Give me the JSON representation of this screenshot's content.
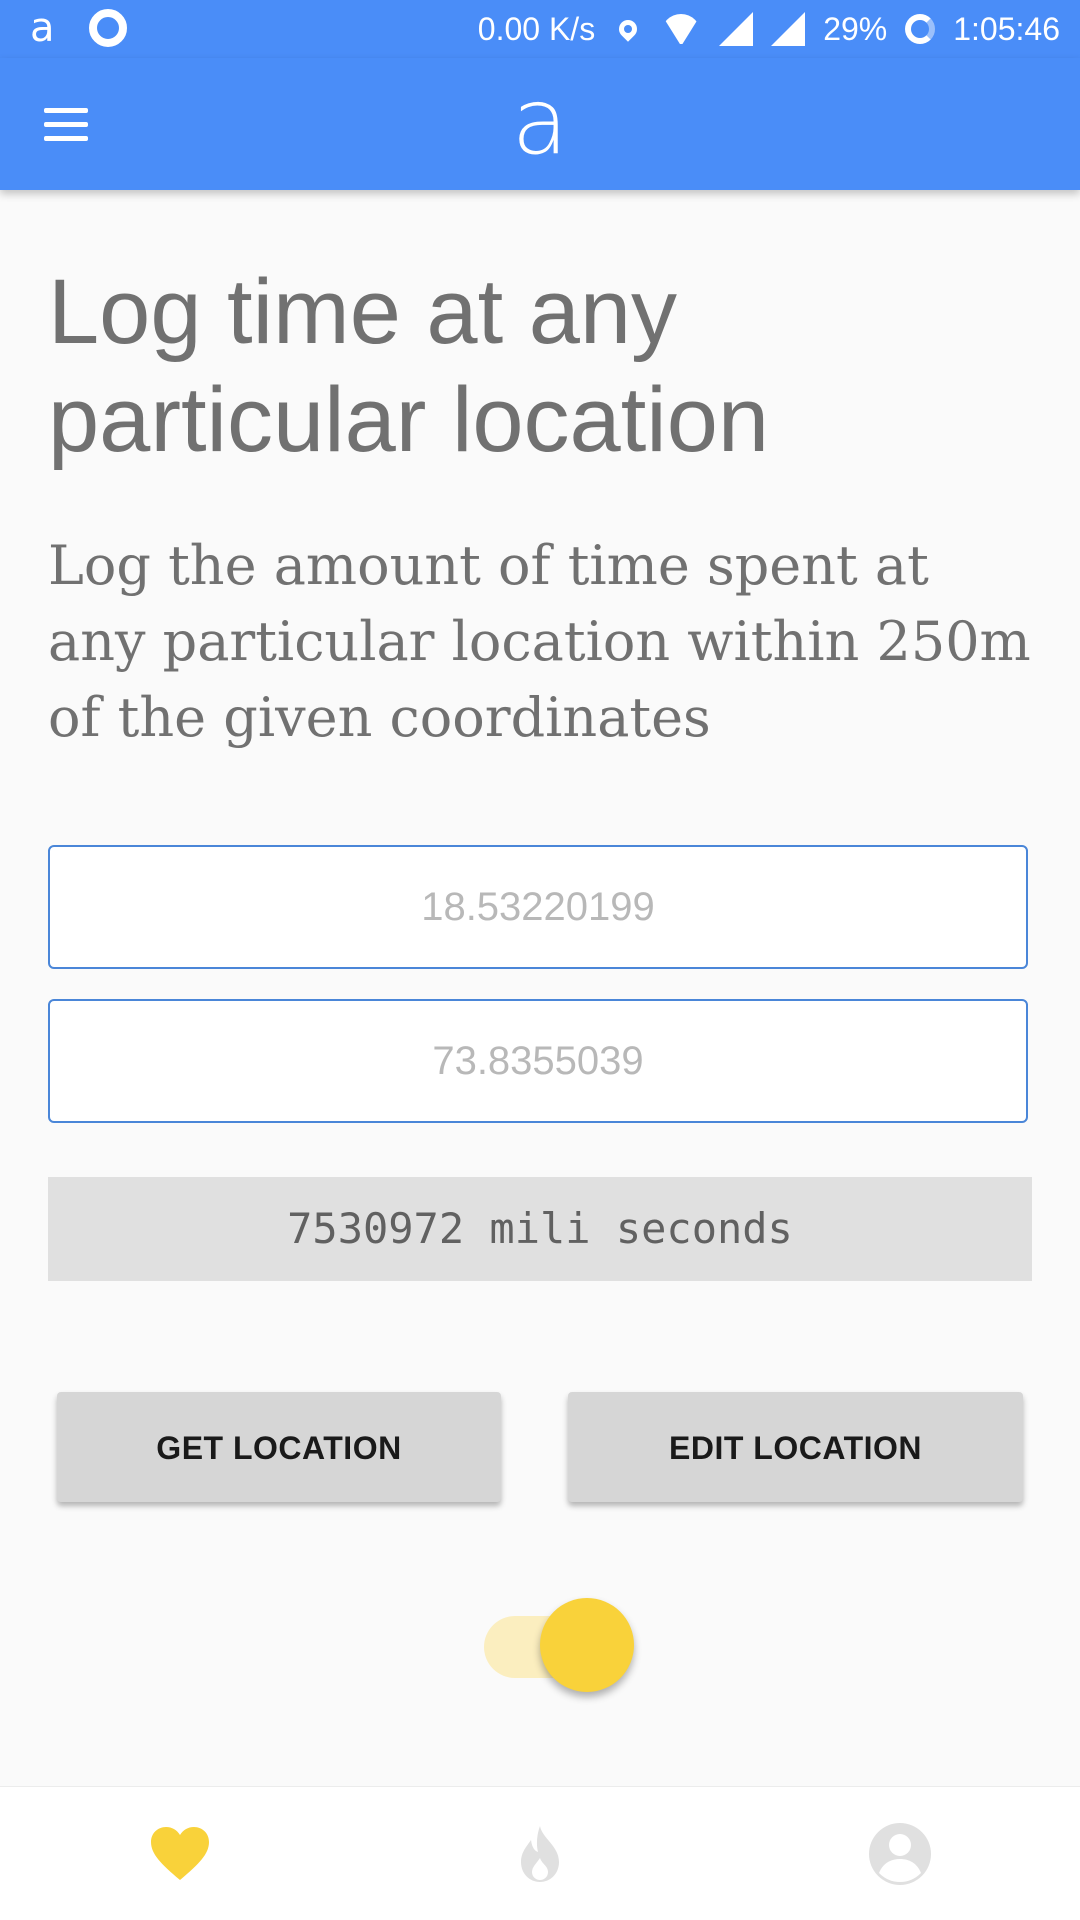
{
  "status_bar": {
    "network_speed": "0.00 K/s",
    "battery": "29%",
    "time": "1:05:46",
    "app_icon": "a",
    "icons": [
      "app-icon",
      "ring-icon",
      "location-icon",
      "wifi-icon",
      "signal-icon",
      "signal-icon",
      "battery-icon"
    ]
  },
  "app_bar": {
    "logo": "a",
    "menu_icon": "menu-icon"
  },
  "content": {
    "title": "Log time at any particular location",
    "description": "Log the amount of time spent at any particular location within 250m of the given coordinates",
    "latitude_placeholder": "18.53220199",
    "longitude_placeholder": "73.8355039",
    "time_display": "7530972 mili seconds",
    "get_location_label": "GET LOCATION",
    "edit_location_label": "EDIT LOCATION",
    "tracking_toggle_on": true
  },
  "bottom_nav": {
    "items": [
      {
        "icon": "heart-icon",
        "active": true
      },
      {
        "icon": "flame-icon",
        "active": false
      },
      {
        "icon": "profile-icon",
        "active": false
      }
    ]
  },
  "colors": {
    "primary": "#4a8df8",
    "accent": "#f9d23a",
    "text_gray": "#717171"
  }
}
